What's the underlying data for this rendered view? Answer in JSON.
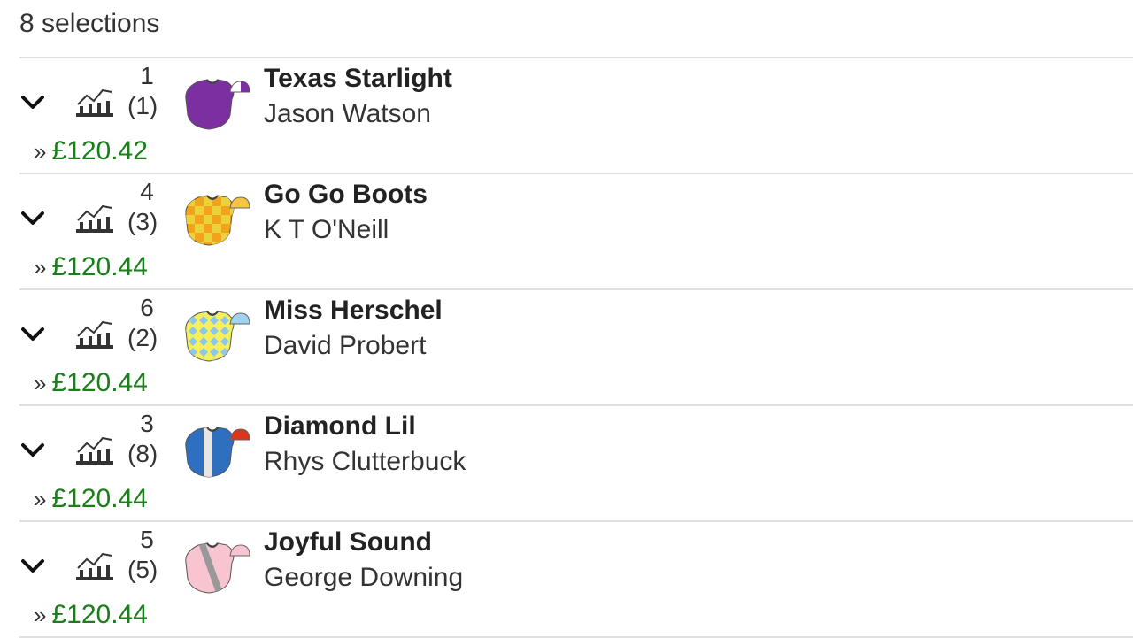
{
  "header": {
    "count_text": "8 selections"
  },
  "runners": [
    {
      "number": "1",
      "draw": "(1)",
      "name": "Texas Starlight",
      "jockey": "Jason Watson",
      "price": "£120.42",
      "silk": {
        "body": "#7b2fa0",
        "sleeves": "#7b2fa0",
        "cap": "#ffffff",
        "cap_accent": "#7b2fa0",
        "pattern": "plain"
      }
    },
    {
      "number": "4",
      "draw": "(3)",
      "name": "Go Go Boots",
      "jockey": "K T O'Neill",
      "price": "£120.44",
      "silk": {
        "body": "#f2a21b",
        "sleeves": "#f5c542",
        "cap": "#f5c542",
        "cap_accent": "#f5c542",
        "pattern": "checks",
        "pattern_color": "#e9d23a"
      }
    },
    {
      "number": "6",
      "draw": "(2)",
      "name": "Miss Herschel",
      "jockey": "David Probert",
      "price": "£120.44",
      "silk": {
        "body": "#f4ef5a",
        "sleeves": "#f4ef5a",
        "cap": "#9fd3f0",
        "cap_accent": "#9fd3f0",
        "pattern": "diamonds",
        "pattern_color": "#8fc7ec"
      }
    },
    {
      "number": "3",
      "draw": "(8)",
      "name": "Diamond Lil",
      "jockey": "Rhys Clutterbuck",
      "price": "£120.44",
      "silk": {
        "body": "#2f6fbf",
        "sleeves": "#2f6fbf",
        "cap": "#d9361b",
        "cap_accent": "#d9361b",
        "pattern": "stripe",
        "pattern_color": "#e6e6e6"
      }
    },
    {
      "number": "5",
      "draw": "(5)",
      "name": "Joyful Sound",
      "jockey": "George Downing",
      "price": "£120.44",
      "silk": {
        "body": "#f7c4cf",
        "sleeves": "#f7c4cf",
        "cap": "#f7c4cf",
        "cap_accent": "#f7c4cf",
        "pattern": "sash",
        "pattern_color": "#999999"
      }
    }
  ]
}
